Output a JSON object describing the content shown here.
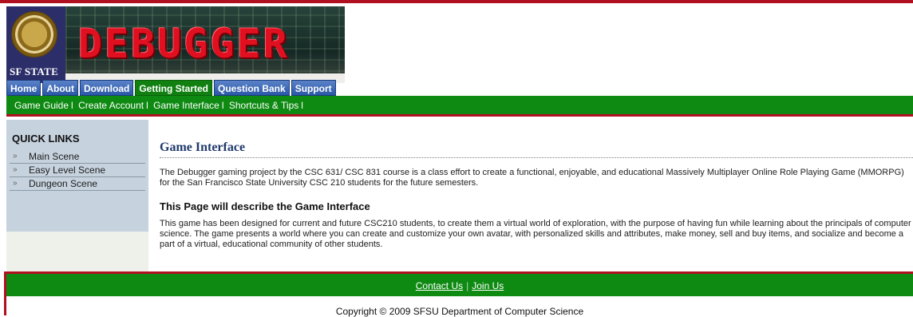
{
  "header": {
    "logo_text": "DEBUGGER",
    "university_label": "SF STATE",
    "colors": {
      "nav_tab": "#2a58a8",
      "nav_tab_active": "#108010",
      "green_bar": "#0e8a12",
      "accent_red": "#b01020"
    }
  },
  "nav": {
    "tabs": [
      {
        "label": "Home",
        "active": false
      },
      {
        "label": "About",
        "active": false
      },
      {
        "label": "Download",
        "active": false
      },
      {
        "label": "Getting Started",
        "active": true
      },
      {
        "label": "Question Bank",
        "active": false
      },
      {
        "label": "Support",
        "active": false
      }
    ]
  },
  "subnav": {
    "items": [
      "Game Guide",
      "Create Account",
      "Game Interface",
      "Shortcuts & Tips"
    ],
    "separator": "l"
  },
  "sidebar": {
    "title": "QUICK LINKS",
    "links": [
      "Main Scene",
      "Easy Level Scene",
      "Dungeon Scene"
    ],
    "arrow_glyph": "»"
  },
  "main": {
    "title": "Game Interface",
    "intro": "The Debugger gaming project by the CSC 631/ CSC 831 course is a class effort to create a functional, enjoyable, and educational Massively Multiplayer Online Role Playing Game (MMORPG) for the San Francisco State University CSC 210 students for the future semesters.",
    "subheading": "This Page will describe the Game Interface",
    "body": "This game has been designed for current and future CSC210 students, to create them a virtual world of exploration, with the purpose of having fun while learning about the principals of computer science. The game presents a world where you can create and customize your own avatar, with personalized skills and attributes, make money, sell and buy items, and socialize and become a part of a virtual, educational community of other students."
  },
  "footer": {
    "links": [
      "Contact Us",
      "Join Us"
    ],
    "separator": "|",
    "copyright": "Copyright © 2009 SFSU Department of Computer Science"
  }
}
